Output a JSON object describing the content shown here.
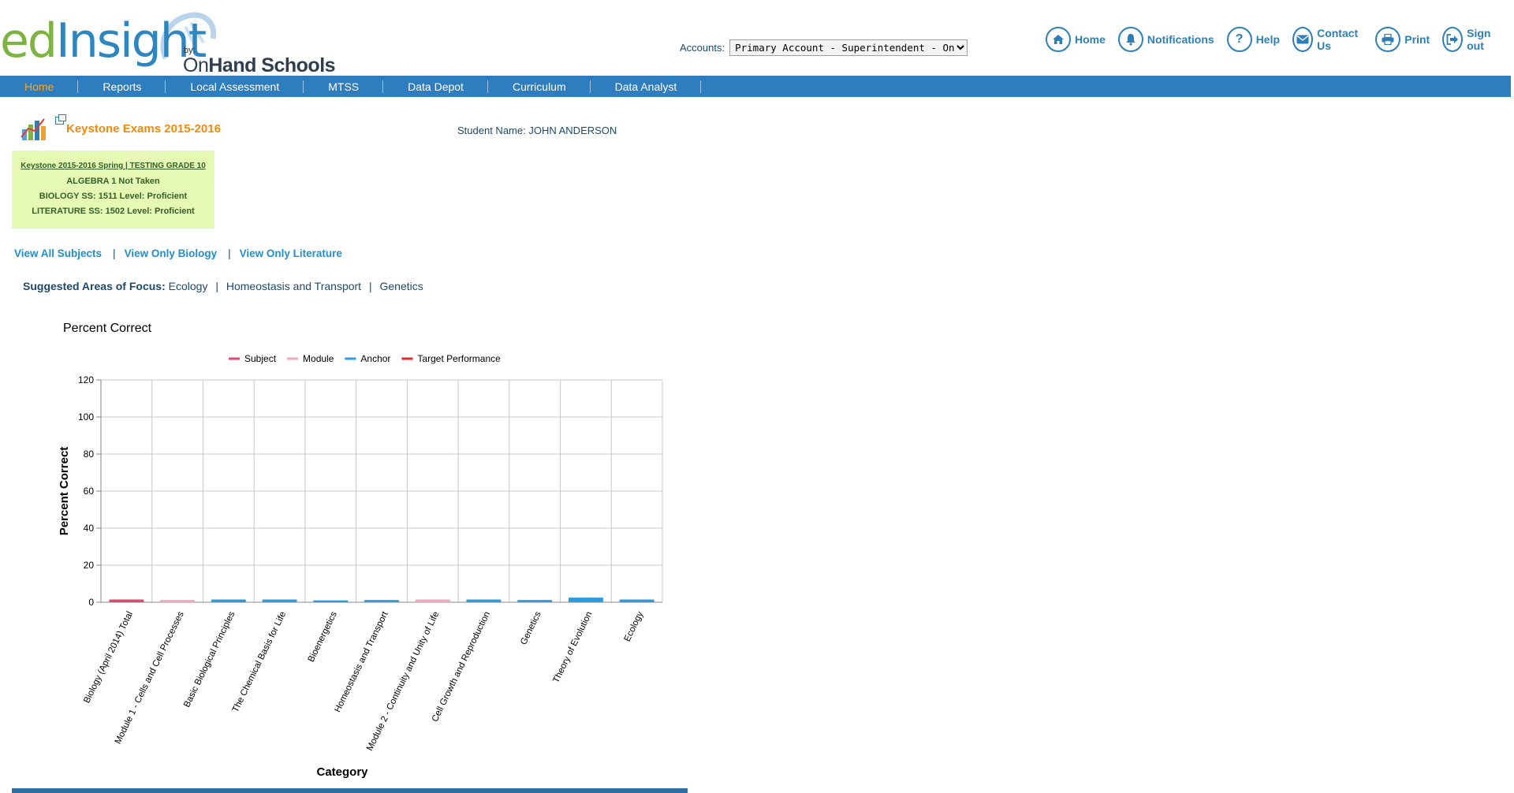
{
  "logo": {
    "ed": "ed",
    "insight": "Insight",
    "by": "by:",
    "company_on": "On",
    "company_rest": "Hand Schools"
  },
  "accounts": {
    "label": "Accounts:",
    "selected": "Primary Account - Superintendent - OnHand Sch"
  },
  "top_links": [
    {
      "label": "Home",
      "icon": "home-icon"
    },
    {
      "label": "Notifications",
      "icon": "bell-icon"
    },
    {
      "label": "Help",
      "icon": "question-icon"
    },
    {
      "label": "Contact Us",
      "icon": "envelope-icon"
    },
    {
      "label": "Print",
      "icon": "printer-icon"
    },
    {
      "label": "Sign out",
      "icon": "sign-out-icon"
    }
  ],
  "nav": {
    "items": [
      "Home",
      "Reports",
      "Local Assessment",
      "MTSS",
      "Data Depot",
      "Curriculum",
      "Data Analyst"
    ],
    "active": "Home"
  },
  "page": {
    "title": "Keystone Exams 2015-2016",
    "student_label": "Student Name:",
    "student_name": "JOHN ANDERSON"
  },
  "score_box": {
    "header": "Keystone 2015-2016 Spring | TESTING GRADE 10",
    "lines": [
      "ALGEBRA 1 Not Taken",
      "BIOLOGY SS: 1511 Level: Proficient",
      "LITERATURE SS: 1502 Level: Proficient"
    ]
  },
  "view_links": [
    "View All Subjects",
    "View Only Biology",
    "View Only Literature"
  ],
  "focus": {
    "label": "Suggested Areas of Focus:",
    "areas": [
      "Ecology",
      "Homeostasis and Transport",
      "Genetics"
    ]
  },
  "colors": {
    "nav": "#2e7dbf",
    "accent_orange": "#f08a0c",
    "link_blue": "#1f8fd1",
    "subject": "#e0476c",
    "module": "#f4a7bd",
    "anchor": "#2d9be0",
    "target": "#e0282c"
  },
  "chart_data": {
    "type": "bar",
    "title": "Percent Correct",
    "xlabel": "Category",
    "ylabel": "Percent Correct",
    "ylim": [
      0,
      120
    ],
    "yticks": [
      0,
      20,
      40,
      60,
      80,
      100,
      120
    ],
    "grid": true,
    "legend_position": "top",
    "legend": [
      {
        "name": "Subject",
        "color": "#e0476c"
      },
      {
        "name": "Module",
        "color": "#f4a7bd"
      },
      {
        "name": "Anchor",
        "color": "#2d9be0"
      },
      {
        "name": "Target Performance",
        "color": "#e0282c"
      }
    ],
    "categories": [
      "Biology (April 2014) Total",
      "Module 1 - Cells and Cell Processes",
      "Basic Biological Principles",
      "The Chemical Basis for Life",
      "Bioenergetics",
      "Homeostasis and Transport",
      "Module 2 - Continuity and Unity of Life",
      "Cell Growth and Reproduction",
      "Genetics",
      "Theory of Evolution",
      "Ecology"
    ],
    "types": [
      "Subject",
      "Module",
      "Anchor",
      "Anchor",
      "Anchor",
      "Anchor",
      "Module",
      "Anchor",
      "Anchor",
      "Anchor",
      "Anchor"
    ],
    "values": [
      1.5,
      1.2,
      1.5,
      1.5,
      1.0,
      1.2,
      1.5,
      1.5,
      1.2,
      2.5,
      1.5
    ]
  }
}
